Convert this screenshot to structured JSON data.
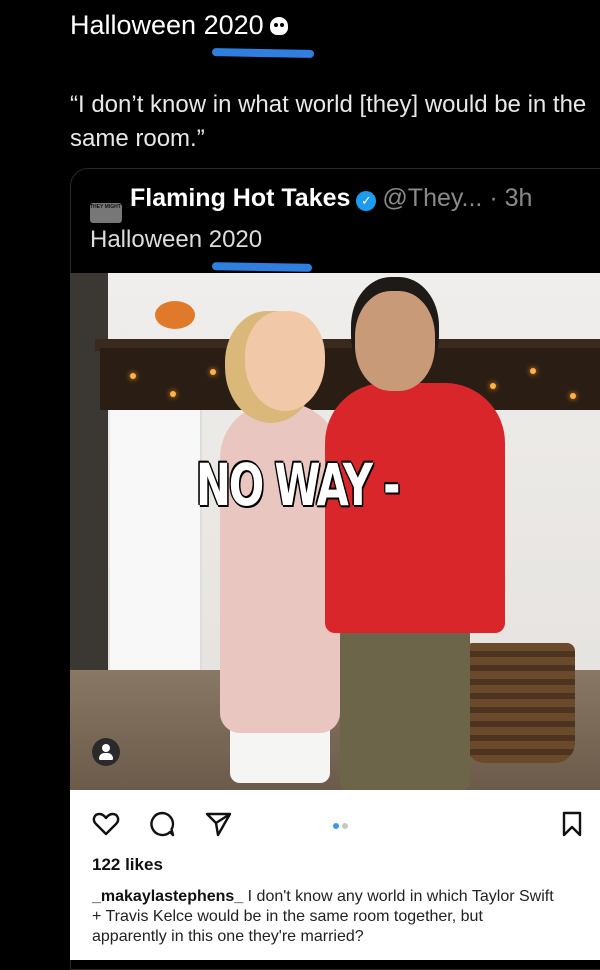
{
  "tweet": {
    "title": "Halloween 2020",
    "quote": "“I don’t know in what world [they] would be in the same room.”"
  },
  "quoted_tweet": {
    "avatar_text": "THEY MIGHTY CREW",
    "name": "Flaming Hot Takes",
    "handle": "@They...",
    "time": "· 3h",
    "text": "Halloween 2020"
  },
  "photo": {
    "overlay_text": "NO WAY -"
  },
  "instagram": {
    "likes": "122 likes",
    "caption_user": "_makaylastephens_",
    "caption_text": " I don't know any world in which Taylor Swift + Travis Kelce would be in the same room together, but apparently in this one they're married?"
  },
  "colors": {
    "underline_mark": "#2f7fe0",
    "verified_badge": "#1d9bf0",
    "carousel_active_dot": "#3897f0"
  }
}
